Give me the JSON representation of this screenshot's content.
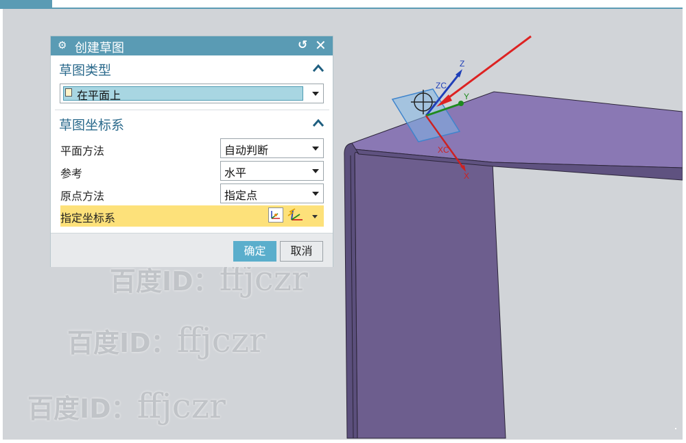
{
  "dialog": {
    "title": "创建草图",
    "icons": {
      "settings": "gear-icon",
      "reset": "reset-icon",
      "close": "close-icon"
    },
    "sketch_type": {
      "heading": "草图类型",
      "selected": "在平面上"
    },
    "sketch_csys": {
      "heading": "草图坐标系",
      "plane_method": {
        "label": "平面方法",
        "value": "自动判断"
      },
      "reference": {
        "label": "参考",
        "value": "水平"
      },
      "origin_method": {
        "label": "原点方法",
        "value": "指定点"
      },
      "specify_csys": {
        "label": "指定坐标系"
      }
    },
    "ok": "确定",
    "cancel": "取消"
  },
  "viewport": {
    "axes": {
      "z": "Z",
      "zc": "ZC",
      "y": "Y",
      "xc": "XC",
      "x": "X"
    },
    "colors": {
      "model_top": "#8a78b4",
      "model_side": "#6d5e8e",
      "plane": "#7fb5e6",
      "arrow": "#dd2222"
    }
  },
  "watermarks": [
    {
      "prefix": "百度ID：",
      "user": "ffjczr"
    },
    {
      "prefix": "百度ID：",
      "user": "ffjczr"
    },
    {
      "prefix": "百度ID：",
      "user": "ffjczr"
    }
  ],
  "colors": {
    "accent": "#5a9bb4",
    "highlight": "#fde17a",
    "ok_button": "#5aaecc"
  }
}
